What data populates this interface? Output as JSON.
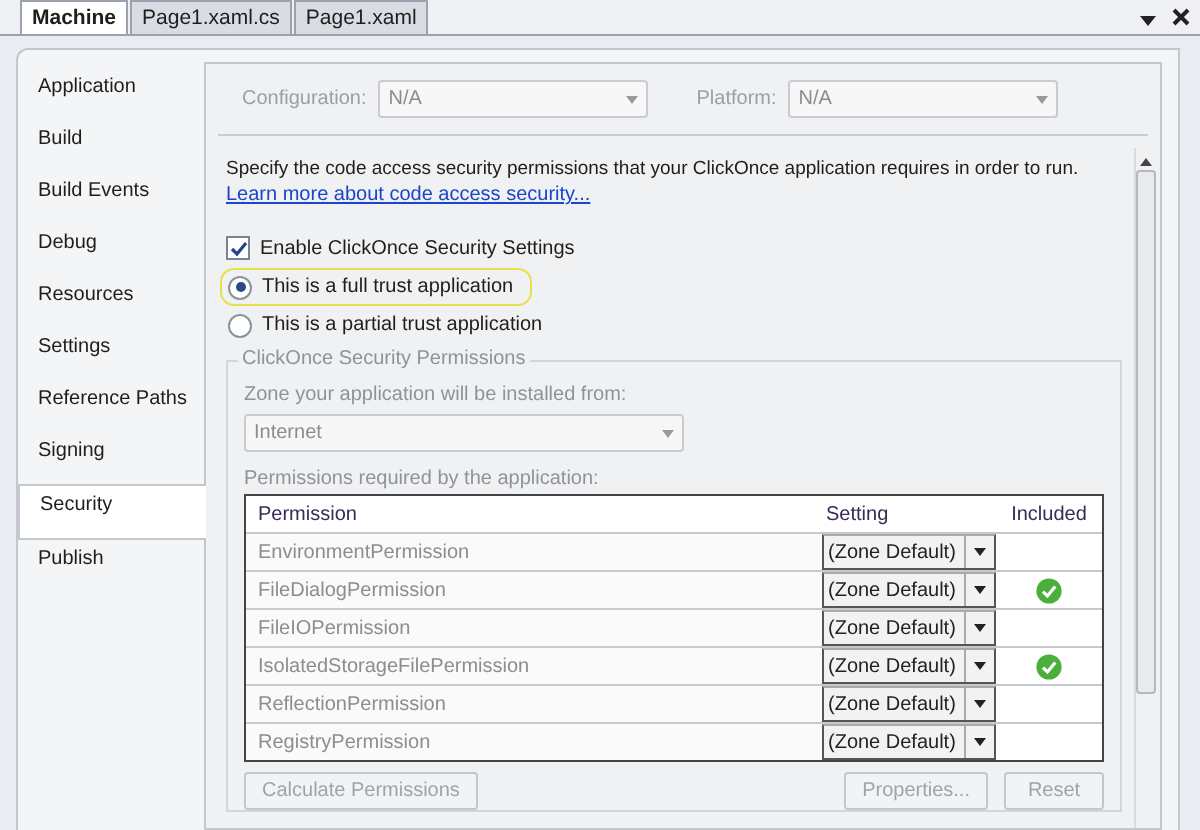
{
  "tabs": [
    {
      "label": "Machine",
      "selected": true
    },
    {
      "label": "Page1.xaml.cs",
      "selected": false
    },
    {
      "label": "Page1.xaml",
      "selected": false
    }
  ],
  "sidebar": {
    "items": [
      {
        "label": "Application",
        "selected": false
      },
      {
        "label": "Build",
        "selected": false
      },
      {
        "label": "Build Events",
        "selected": false
      },
      {
        "label": "Debug",
        "selected": false
      },
      {
        "label": "Resources",
        "selected": false
      },
      {
        "label": "Settings",
        "selected": false
      },
      {
        "label": "Reference Paths",
        "selected": false
      },
      {
        "label": "Signing",
        "selected": false
      },
      {
        "label": "Security",
        "selected": true
      },
      {
        "label": "Publish",
        "selected": false
      }
    ]
  },
  "configuration": {
    "label": "Configuration:",
    "value": "N/A",
    "disabled": true
  },
  "platform": {
    "label": "Platform:",
    "value": "N/A",
    "disabled": true
  },
  "description": "Specify the code access security permissions that your ClickOnce application requires in order to run.",
  "link": "Learn more about code access security...",
  "enable_checkbox": {
    "label": "Enable ClickOnce Security Settings",
    "checked": true
  },
  "trust_options": [
    {
      "label": "This is a full trust application",
      "selected": true
    },
    {
      "label": "This is a partial trust application",
      "selected": false
    }
  ],
  "permissions_group": {
    "title": "ClickOnce Security Permissions",
    "disabled": true,
    "zone_label": "Zone your application will be installed from:",
    "zone_value": "Internet",
    "table_label": "Permissions required by the application:",
    "columns": [
      "Permission",
      "Setting",
      "Included"
    ],
    "rows": [
      {
        "permission": "EnvironmentPermission",
        "setting": "(Zone Default)",
        "included": false
      },
      {
        "permission": "FileDialogPermission",
        "setting": "(Zone Default)",
        "included": true
      },
      {
        "permission": "FileIOPermission",
        "setting": "(Zone Default)",
        "included": false
      },
      {
        "permission": "IsolatedStorageFilePermission",
        "setting": "(Zone Default)",
        "included": true
      },
      {
        "permission": "ReflectionPermission",
        "setting": "(Zone Default)",
        "included": false
      },
      {
        "permission": "RegistryPermission",
        "setting": "(Zone Default)",
        "included": false
      }
    ],
    "buttons": [
      "Calculate Permissions",
      "Properties...",
      "Reset"
    ]
  }
}
